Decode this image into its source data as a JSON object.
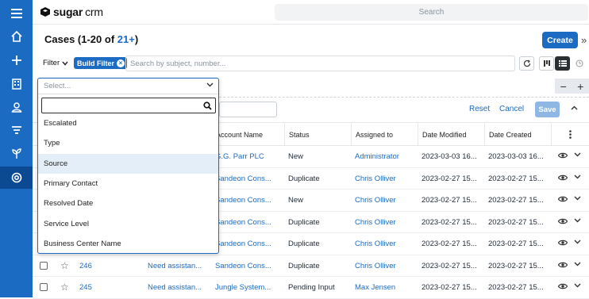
{
  "app": {
    "logo_bold": "sugar",
    "logo_light": "crm",
    "global_search_placeholder": "Search"
  },
  "sidebar": {
    "items": [
      {
        "icon": "menu-icon"
      },
      {
        "icon": "home-icon"
      },
      {
        "icon": "plus-icon"
      },
      {
        "icon": "building-icon"
      },
      {
        "icon": "user-icon"
      },
      {
        "icon": "filter-funnel-icon"
      },
      {
        "icon": "plant-icon"
      },
      {
        "icon": "cases-icon",
        "active": true
      }
    ],
    "color": "#1b6bc2",
    "active_color": "#0b4a93"
  },
  "header": {
    "title_prefix": "Cases (1-20 of ",
    "title_count": "21+",
    "title_suffix": ")",
    "create_label": "Create",
    "collapse_label": "»"
  },
  "filterbar": {
    "filter_label": "Filter",
    "build_filter_label": "Build Filter",
    "search_placeholder": "Search by subject, number..."
  },
  "filter_editor": {
    "reset_label": "Reset",
    "cancel_label": "Cancel",
    "save_label": "Save"
  },
  "dropdown": {
    "placeholder": "Select...",
    "options": [
      "Escalated",
      "Type",
      "Source",
      "Primary Contact",
      "Resolved Date",
      "Service Level",
      "Business Center Name"
    ],
    "highlighted": "Source"
  },
  "table": {
    "headers": {
      "account_name": "Account Name",
      "status": "Status",
      "assigned_to": "Assigned to",
      "date_modified": "Date Modified",
      "date_created": "Date Created"
    },
    "rows": [
      {
        "number": "",
        "subject": "",
        "account": "G.G. Parr PLC",
        "status": "New",
        "assigned": "Administrator",
        "modified": "2023-03-03 16...",
        "created": "2023-03-03 16..."
      },
      {
        "number": "",
        "subject": "",
        "account": "Sandeon Cons...",
        "status": "Duplicate",
        "assigned": "Chris Olliver",
        "modified": "2023-02-27 15...",
        "created": "2023-02-27 15..."
      },
      {
        "number": "",
        "subject": "",
        "account": "Sandeon Cons...",
        "status": "New",
        "assigned": "Chris Olliver",
        "modified": "2023-02-27 15...",
        "created": "2023-02-27 15..."
      },
      {
        "number": "",
        "subject": "",
        "account": "Sandeon Cons...",
        "status": "Duplicate",
        "assigned": "Chris Olliver",
        "modified": "2023-02-27 15...",
        "created": "2023-02-27 15..."
      },
      {
        "number": "",
        "subject": "",
        "account": "Sandeon Cons...",
        "status": "Duplicate",
        "assigned": "Chris Olliver",
        "modified": "2023-02-27 15...",
        "created": "2023-02-27 15..."
      },
      {
        "number": "246",
        "subject": "Need assistan...",
        "account": "Sandeon Cons...",
        "status": "Duplicate",
        "assigned": "Chris Olliver",
        "modified": "2023-02-27 15...",
        "created": "2023-02-27 15..."
      },
      {
        "number": "245",
        "subject": "Need assistan...",
        "account": "Jungle System...",
        "status": "Pending Input",
        "assigned": "Max Jensen",
        "modified": "2023-02-27 15...",
        "created": "2023-02-27 15..."
      }
    ]
  }
}
